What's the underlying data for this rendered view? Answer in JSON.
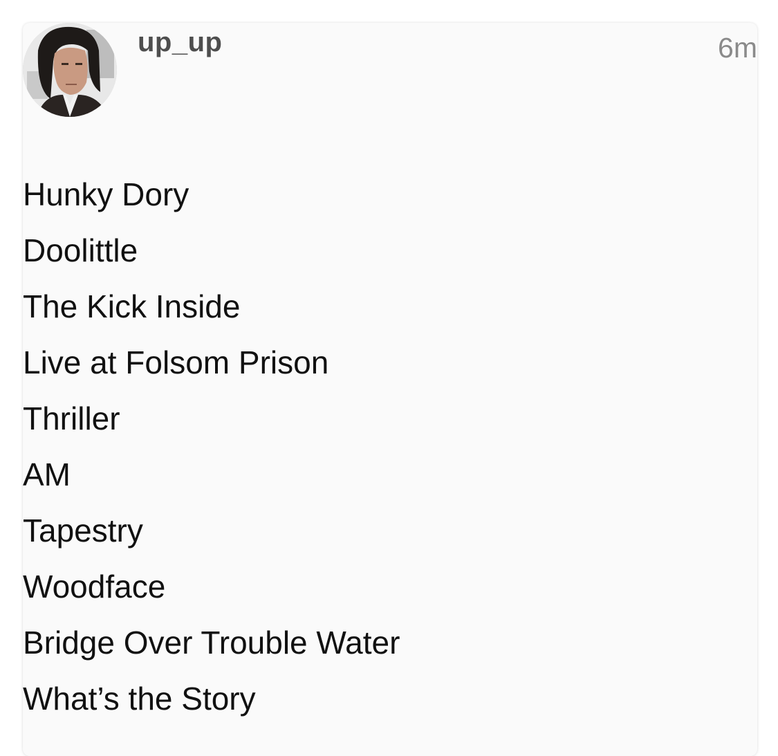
{
  "post": {
    "username": "up_up",
    "timestamp": "6m",
    "avatar_icon": "user-avatar-photo",
    "items": [
      "Hunky Dory",
      "Doolittle",
      "The Kick Inside",
      "Live at Folsom Prison",
      "Thriller",
      "AM",
      "Tapestry",
      "Woodface",
      "Bridge Over Trouble Water",
      "What’s the Story"
    ]
  },
  "colors": {
    "background": "#ffffff",
    "card": "#fafafa",
    "username": "#4e4e4e",
    "timestamp": "#8a8a8a",
    "text": "#111111"
  }
}
